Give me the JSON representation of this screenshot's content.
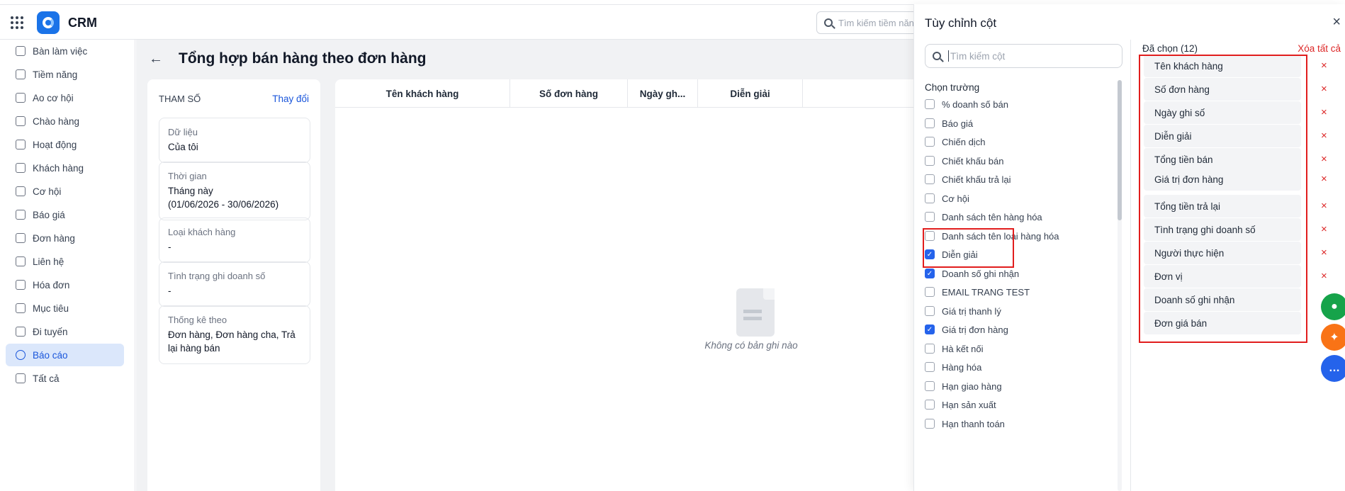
{
  "app": {
    "brand": "CRM",
    "top_search_placeholder": "Tìm kiếm tiềm năng"
  },
  "sidebar": {
    "items": [
      {
        "label": "Bàn làm việc",
        "icon": "home-icon"
      },
      {
        "label": "Tiềm năng",
        "icon": "target-user-icon"
      },
      {
        "label": "Ao cơ hội",
        "icon": "pool-icon"
      },
      {
        "label": "Chào hàng",
        "icon": "magnet-icon"
      },
      {
        "label": "Hoạt động",
        "icon": "activity-icon"
      },
      {
        "label": "Khách hàng",
        "icon": "building-icon"
      },
      {
        "label": "Cơ hội",
        "icon": "opportunity-icon"
      },
      {
        "label": "Báo giá",
        "icon": "quote-icon"
      },
      {
        "label": "Đơn hàng",
        "icon": "cart-icon"
      },
      {
        "label": "Liên hệ",
        "icon": "contact-icon"
      },
      {
        "label": "Hóa đơn",
        "icon": "invoice-icon"
      },
      {
        "label": "Mục tiêu",
        "icon": "goal-icon"
      },
      {
        "label": "Đi tuyến",
        "icon": "route-icon"
      },
      {
        "label": "Báo cáo",
        "icon": "report-icon",
        "active": true
      },
      {
        "label": "Tất cả",
        "icon": "menu-icon"
      }
    ]
  },
  "page": {
    "title": "Tổng hợp bán hàng theo đơn hàng"
  },
  "params": {
    "heading": "THAM SỐ",
    "change_label": "Thay đổi",
    "cards": [
      {
        "label": "Dữ liệu",
        "value": "Của tôi"
      },
      {
        "label": "Thời gian",
        "value": "Tháng này",
        "value2": "(01/06/2026 - 30/06/2026)"
      },
      {
        "label": "Loại khách hàng",
        "value": "-"
      },
      {
        "label": "Tình trạng ghi doanh số",
        "value": "-"
      },
      {
        "label": "Thống kê theo",
        "value": "Đơn hàng, Đơn hàng cha, Trả",
        "value2": "lại hàng bán"
      }
    ]
  },
  "table": {
    "columns": [
      "Tên khách hàng",
      "Số đơn hàng",
      "Ngày gh...",
      "Diễn giải"
    ],
    "empty_text": "Không có bản ghi nào"
  },
  "column_panel": {
    "title": "Tùy chỉnh cột",
    "search_placeholder": "Tìm kiếm cột",
    "choose_label": "Chọn trường",
    "fields": [
      {
        "label": "% doanh số bán",
        "checked": false
      },
      {
        "label": "Báo giá",
        "checked": false
      },
      {
        "label": "Chiến dịch",
        "checked": false
      },
      {
        "label": "Chiết khấu bán",
        "checked": false
      },
      {
        "label": "Chiết khấu trả lại",
        "checked": false
      },
      {
        "label": "Cơ hội",
        "checked": false
      },
      {
        "label": "Danh sách tên hàng hóa",
        "checked": false
      },
      {
        "label": "Danh sách tên loại hàng hóa",
        "checked": false
      },
      {
        "label": "Diễn giải",
        "checked": true
      },
      {
        "label": "Doanh số ghi nhận",
        "checked": true
      },
      {
        "label": "EMAIL TRANG TEST",
        "checked": false
      },
      {
        "label": "Giá trị thanh lý",
        "checked": false
      },
      {
        "label": "Giá trị đơn hàng",
        "checked": true
      },
      {
        "label": "Hà kết nối",
        "checked": false
      },
      {
        "label": "Hàng hóa",
        "checked": false
      },
      {
        "label": "Hạn giao hàng",
        "checked": false
      },
      {
        "label": "Hạn sản xuất",
        "checked": false
      },
      {
        "label": "Hạn thanh toán",
        "checked": false
      }
    ],
    "selected_count_label": "Đã chọn (12)",
    "clear_all_label": "Xóa tất cả",
    "selected": [
      "Tên khách hàng",
      "Số đơn hàng",
      "Ngày ghi số",
      "Diễn giải",
      "Tổng tiền bán",
      "Giá trị đơn hàng",
      "Tổng tiền trả lại",
      "Tình trạng ghi doanh số",
      "Người thực hiện",
      "Đơn vị",
      "Doanh số ghi nhận",
      "Đơn giá bán"
    ],
    "remove_icon": "×"
  },
  "colors": {
    "accent": "#1a56db",
    "danger": "#dc2626",
    "highlight": "#e11d1d"
  }
}
